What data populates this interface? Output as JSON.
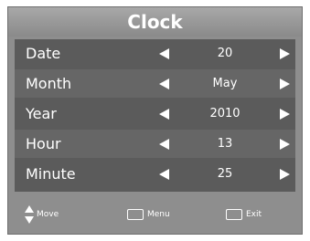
{
  "title": "Clock",
  "rows": [
    {
      "label": "Date",
      "value": "20"
    },
    {
      "label": "Month",
      "value": "May"
    },
    {
      "label": "Year",
      "value": "2010"
    },
    {
      "label": "Hour",
      "value": "13"
    },
    {
      "label": "Minute",
      "value": "25"
    }
  ],
  "footer": {
    "move": "Move",
    "menu": "Menu",
    "exit": "Exit"
  },
  "icons": {
    "left": "arrow-left-icon",
    "right": "arrow-right-icon",
    "move": "up-down-arrows-icon",
    "menu_key": "menu-key-icon",
    "exit_key": "exit-key-icon"
  },
  "colors": {
    "frame": "#8e8e8e",
    "panel": "#5b5b5b",
    "text": "#ffffff"
  }
}
